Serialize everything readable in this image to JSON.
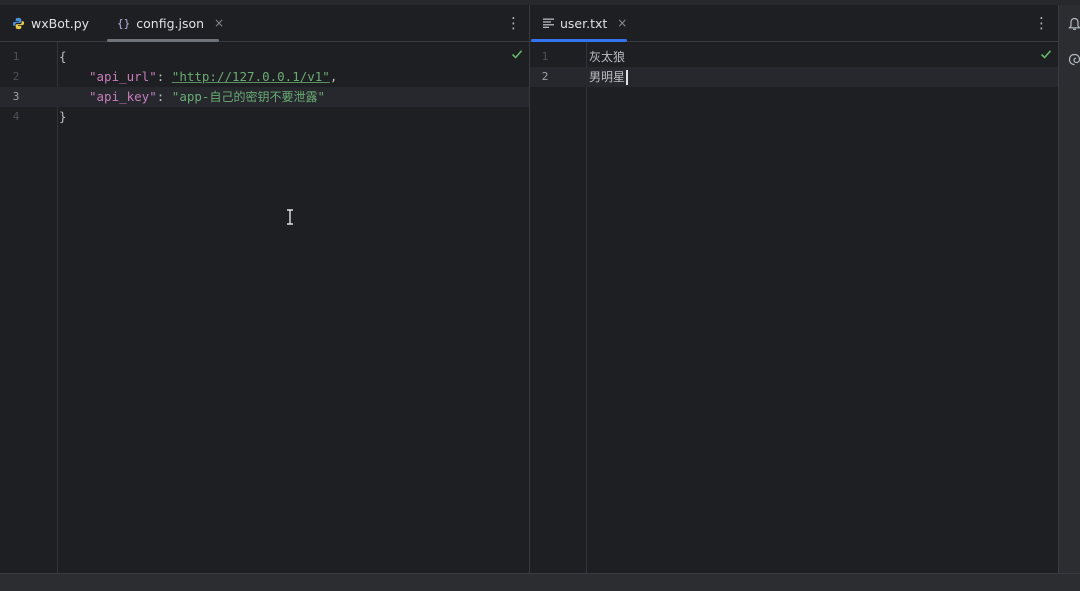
{
  "left_pane": {
    "tabs": [
      {
        "label": "wxBot.py",
        "icon": "python-file-icon",
        "active": false
      },
      {
        "label": "config.json",
        "icon": "json-file-icon",
        "active": true,
        "close": "×"
      }
    ],
    "menu_glyph": "⋮",
    "lines": [
      {
        "number": "1",
        "text": "{"
      },
      {
        "number": "2",
        "key": "\"api_url\"",
        "sep": ": ",
        "value": "\"http://127.0.0.1/v1\"",
        "trail": ","
      },
      {
        "number": "3",
        "key": "\"api_key\"",
        "sep": ": ",
        "value_prefix": "\"app-",
        "value_zh": "自己的密钥不要泄露",
        "value_end": "\""
      },
      {
        "number": "4",
        "text": "}"
      }
    ],
    "current_line": "3"
  },
  "right_pane": {
    "tab": {
      "label": "user.txt",
      "icon": "text-file-icon",
      "active": true,
      "close": "×"
    },
    "menu_glyph": "⋮",
    "lines": [
      {
        "number": "1",
        "text": "灰太狼"
      },
      {
        "number": "2",
        "text": "男明星"
      }
    ],
    "current_line": "2"
  },
  "colors": {
    "background": "#1e1f22",
    "tab_underline": "#3574f0",
    "json_key": "#c77dbb",
    "json_string": "#6aab73",
    "check": "#5fb865"
  }
}
